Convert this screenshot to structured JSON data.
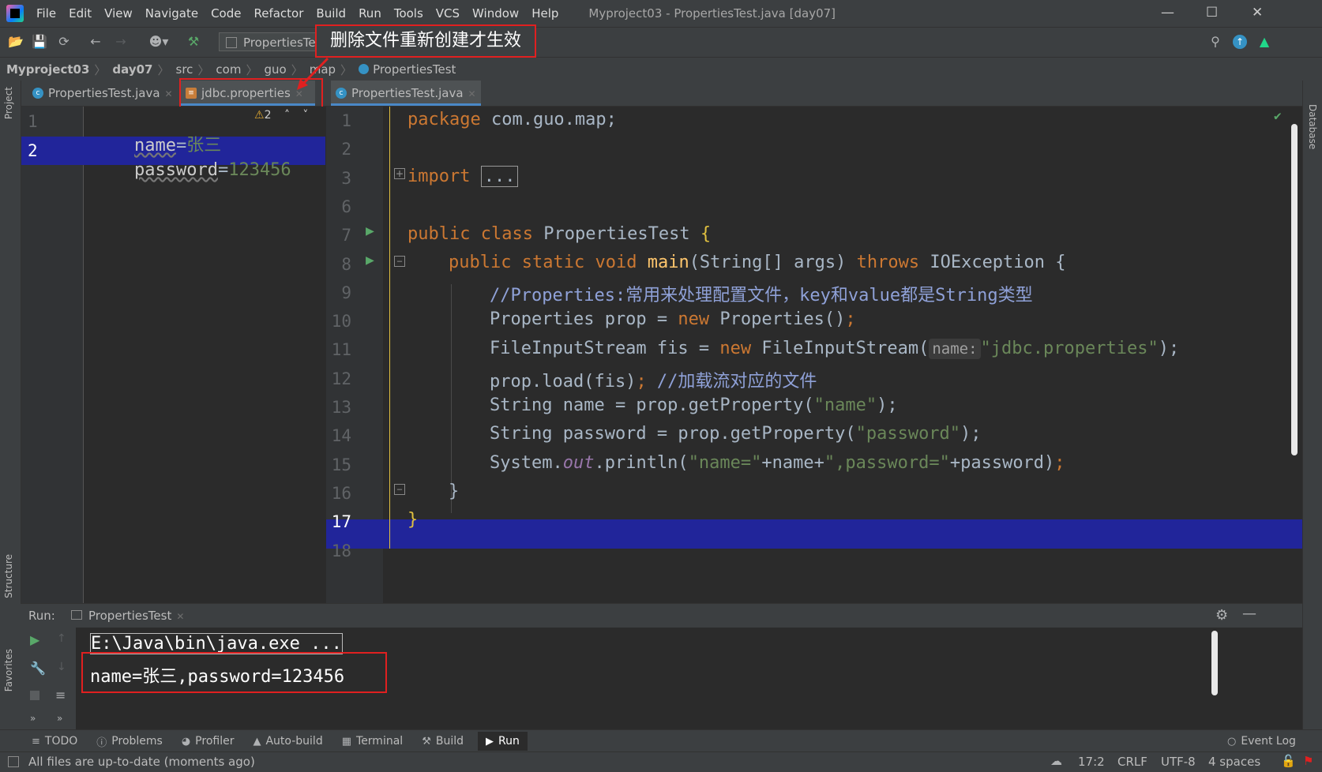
{
  "menu": {
    "items": [
      "File",
      "Edit",
      "View",
      "Navigate",
      "Code",
      "Refactor",
      "Build",
      "Run",
      "Tools",
      "VCS",
      "Window",
      "Help"
    ],
    "window_title": "Myproject03 - PropertiesTest.java [day07]"
  },
  "toolbar": {
    "run_config": "PropertiesTest",
    "annotation": "删除文件重新创建才生效"
  },
  "breadcrumb": [
    "Myproject03",
    "day07",
    "src",
    "com",
    "guo",
    "map",
    "PropertiesTest"
  ],
  "left_strip": {
    "project": "Project",
    "structure": "Structure",
    "favorites": "Favorites"
  },
  "right_strip": {
    "database": "Database"
  },
  "tabs_left": [
    {
      "label": "PropertiesTest.java"
    },
    {
      "label": "jdbc.properties"
    }
  ],
  "tabs_right": [
    {
      "label": "PropertiesTest.java"
    }
  ],
  "props_editor": {
    "warning_count": "2",
    "lines": [
      {
        "num": "1",
        "key": "name",
        "eq": "=",
        "value": "张三"
      },
      {
        "num": "2",
        "key": "password",
        "eq": "=",
        "value": "123456"
      }
    ]
  },
  "java_editor": {
    "line_numbers": [
      "1",
      "2",
      "3",
      "6",
      "7",
      "8",
      "9",
      "10",
      "11",
      "12",
      "13",
      "14",
      "15",
      "16",
      "17",
      "18"
    ],
    "l1_kw": "package",
    "l1_rest": " com.guo.map;",
    "l3_kw": "import",
    "l3_fold": "...",
    "l7_kw1": "public",
    "l7_kw2": "class",
    "l7_name": " PropertiesTest ",
    "l7_brace": "{",
    "l8_kw1": "public",
    "l8_kw2": "static",
    "l8_kw3": "void",
    "l8_name": "main",
    "l8_params": "(String[] args) ",
    "l8_throws": "throws",
    "l8_rest": " IOException {",
    "l9_comment": "//Properties:常用来处理配置文件，key和value都是String类型",
    "l10_a": "Properties prop = ",
    "l10_new": "new",
    "l10_b": " Properties()",
    ";": ";",
    "l11_a": "FileInputStream fis = ",
    "l11_new": "new",
    "l11_b": " FileInputStream(",
    "l11_hint": "name:",
    "l11_str": "\"jdbc.properties\"",
    "l11_end": ");",
    "l12_a": "prop.load(fis)",
    "l12_semi": ";",
    "l12_comment": " //加载流对应的文件",
    "l13_a": "String name = prop.getProperty(",
    "l13_str": "\"name\"",
    "l13_end": ");",
    "l14_a": "String password = prop.getProperty(",
    "l14_str": "\"password\"",
    "l14_end": ");",
    "l15_a": "System.",
    "l15_out": "out",
    "l15_b": ".println(",
    "l15_s1": "\"name=\"",
    "l15_c": "+name+",
    "l15_s2": "\",password=\"",
    "l15_d": "+password)",
    "l15_semi": ";",
    "l16": "}",
    "l17": "}"
  },
  "run_panel": {
    "label": "Run:",
    "tab": "PropertiesTest",
    "console": [
      "E:\\Java\\bin\\java.exe ...",
      "name=张三,password=123456"
    ]
  },
  "bottom_tabs": [
    "TODO",
    "Problems",
    "Profiler",
    "Auto-build",
    "Terminal",
    "Build",
    "Run"
  ],
  "bottom_right": "Event Log",
  "status": {
    "message": "All files are up-to-date (moments ago)",
    "position": "17:2",
    "line_sep": "CRLF",
    "encoding": "UTF-8",
    "indent": "4 spaces"
  },
  "colors": {
    "accent": "#e02020",
    "selection": "#21259a",
    "bg": "#2b2b2b",
    "chrome": "#3c3f41"
  }
}
